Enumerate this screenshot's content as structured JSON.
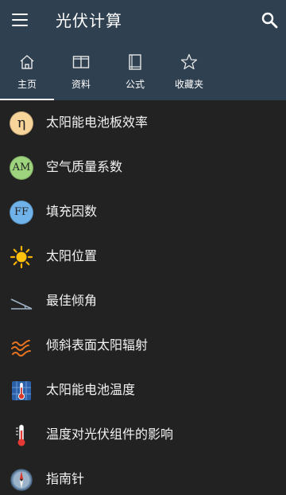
{
  "header": {
    "title": "光伏计算"
  },
  "tabs": [
    {
      "label": "主页",
      "icon": "home-icon",
      "active": true
    },
    {
      "label": "资料",
      "icon": "book-open-icon",
      "active": false
    },
    {
      "label": "公式",
      "icon": "book-closed-icon",
      "active": false
    },
    {
      "label": "收藏夹",
      "icon": "star-icon",
      "active": false
    }
  ],
  "list": [
    {
      "label": "太阳能电池板效率",
      "icon": "eta-badge-icon",
      "badge_text": "η"
    },
    {
      "label": "空气质量系数",
      "icon": "am-badge-icon",
      "badge_text": "AM"
    },
    {
      "label": "填充因数",
      "icon": "ff-badge-icon",
      "badge_text": "FF"
    },
    {
      "label": "太阳位置",
      "icon": "sun-icon"
    },
    {
      "label": "最佳倾角",
      "icon": "tilt-angle-icon"
    },
    {
      "label": "倾斜表面太阳辐射",
      "icon": "radiation-icon"
    },
    {
      "label": "太阳能电池温度",
      "icon": "solar-panel-thermometer-icon"
    },
    {
      "label": "温度对光伏组件的影响",
      "icon": "thermometer-icon"
    },
    {
      "label": "指南针",
      "icon": "compass-icon"
    }
  ],
  "colors": {
    "appbar": "#2f4050",
    "background": "#222222",
    "text": "#f2f2f2"
  }
}
